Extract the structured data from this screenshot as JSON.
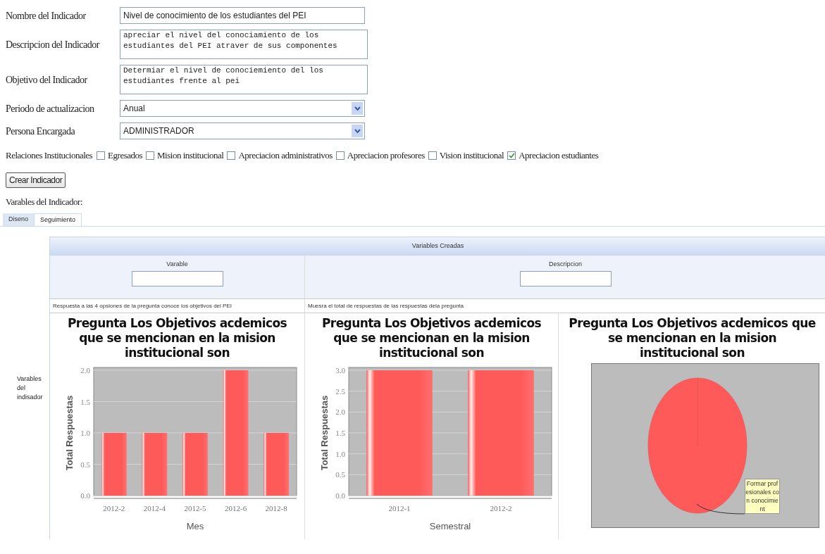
{
  "form": {
    "name": {
      "label": "Nombre del Indicador",
      "value": "Nivel de conocimiento de los estudiantes del PEI"
    },
    "description": {
      "label": "Descripcion del Indicador",
      "value": "apreciar el nivel del conociamiento de los estudiantes del PEI atraver de sus componentes"
    },
    "objective": {
      "label": "Objetivo del Indicador",
      "value": "Determiar el nivel de conociemiento del los estudiantes frente al pei"
    },
    "period": {
      "label": "Periodo de actualizacion",
      "value": "Anual"
    },
    "person": {
      "label": "Persona Encargada",
      "value": "ADMINISTRADOR"
    },
    "relations": {
      "label": "Relaciones Institucionales",
      "options": [
        {
          "label": "Egresados",
          "checked": false
        },
        {
          "label": "Mision institucional",
          "checked": false
        },
        {
          "label": "Apreciacion administrativos",
          "checked": false
        },
        {
          "label": "Apreciacion profesores",
          "checked": false
        },
        {
          "label": "Vision institucional",
          "checked": false
        },
        {
          "label": "Apreciacion estudiantes",
          "checked": true
        }
      ]
    },
    "submit": "Crear Indicador"
  },
  "variables_heading": "Varables del Indicador:",
  "tabs": [
    {
      "label": "Diseno",
      "selected": false
    },
    {
      "label": "Seguimiento",
      "selected": true
    }
  ],
  "side_label": "Varables del indisador",
  "table": {
    "title": "Variables Creadas",
    "fields": [
      {
        "label": "Varable"
      },
      {
        "label": "Descripcion"
      }
    ],
    "descriptions": [
      "Respuesta a las 4 opsiones de la pregunta conoce los objetivos del PEI",
      "Muesra el total de respuestas de las respuestas dela pregunta"
    ],
    "charts": [
      {
        "chart_data": {
          "type": "bar",
          "title": "Pregunta Los Objetivos acdemicos que se mencionan en la mision institucional son",
          "xlabel": "Mes",
          "ylabel": "Total Respuestas",
          "categories": [
            "2012-2",
            "2012-4",
            "2012-5",
            "2012-6",
            "2012-8"
          ],
          "grid": true,
          "series": [
            {
              "color": "#ff5a5a",
              "values": [
                1,
                1,
                1,
                2,
                1
              ]
            }
          ],
          "ylim": [
            0,
            2
          ],
          "yticks": [
            {
              "value": 0,
              "label": "0.0"
            },
            {
              "value": 0.5,
              "label": "0.5"
            },
            {
              "value": 1,
              "label": "1.0"
            },
            {
              "value": 1.5,
              "label": "1.5"
            },
            {
              "value": 2,
              "label": "2.0"
            }
          ]
        }
      },
      {
        "chart_data": {
          "type": "bar",
          "title": "Pregunta Los Objetivos acdemicos que se mencionan en la mision institucional son",
          "xlabel": "Semestral",
          "ylabel": "Total Respuestas",
          "categories": [
            "2012-1",
            "2012-2"
          ],
          "grid": true,
          "series": [
            {
              "color": "#ff5a5a",
              "values": [
                3,
                3
              ]
            }
          ],
          "ylim": [
            0,
            3
          ],
          "yticks": [
            {
              "value": 0,
              "label": "0.0"
            },
            {
              "value": 0.5,
              "label": "0.5"
            },
            {
              "value": 1,
              "label": "1.0"
            },
            {
              "value": 1.5,
              "label": "1.5"
            },
            {
              "value": 2,
              "label": "2.0"
            },
            {
              "value": 2.5,
              "label": "2.5"
            },
            {
              "value": 3,
              "label": "3.0"
            }
          ]
        }
      },
      {
        "chart_data": {
          "type": "pie",
          "title": "Pregunta Los Objetivos acdemicos que se mencionan en la mision institucional son",
          "categories": [
            "Formar profesionales con conocimient"
          ],
          "series": [
            {
              "color": "#ff5a5a",
              "values": [
                1
              ]
            }
          ]
        }
      }
    ]
  }
}
